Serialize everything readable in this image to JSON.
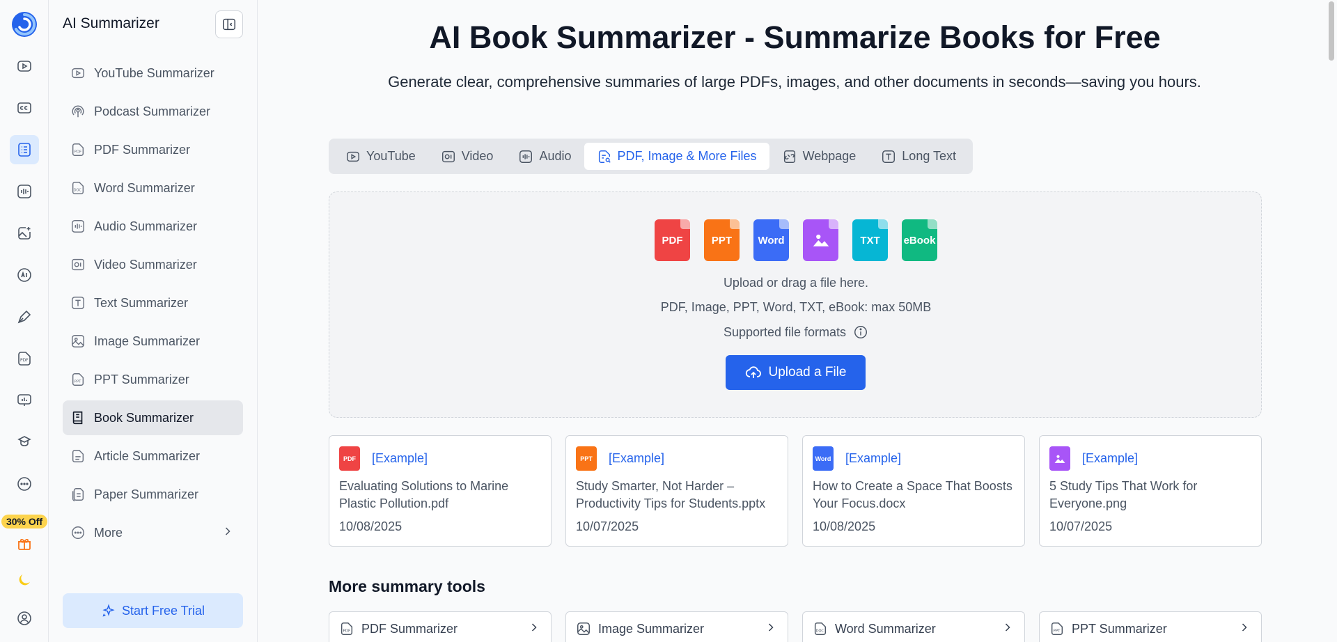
{
  "rail": {
    "items": [
      {
        "icon": "play-video-icon"
      },
      {
        "icon": "closed-caption-icon"
      },
      {
        "icon": "summary-list-icon",
        "active": true
      },
      {
        "icon": "audio-waveform-icon"
      },
      {
        "icon": "ai-image-icon"
      },
      {
        "icon": "ai-chat-icon"
      },
      {
        "icon": "pen-nib-icon"
      },
      {
        "icon": "pdf-file-icon"
      },
      {
        "icon": "presentation-chart-icon"
      },
      {
        "icon": "graduation-cap-icon"
      },
      {
        "icon": "more-dots-icon"
      }
    ],
    "promo_badge": "30% Off"
  },
  "sidebar": {
    "title": "AI Summarizer",
    "items": [
      {
        "label": "YouTube Summarizer",
        "icon": "youtube-icon"
      },
      {
        "label": "Podcast Summarizer",
        "icon": "podcast-icon"
      },
      {
        "label": "PDF Summarizer",
        "icon": "pdf-icon"
      },
      {
        "label": "Word Summarizer",
        "icon": "doc-icon"
      },
      {
        "label": "Audio Summarizer",
        "icon": "audio-icon"
      },
      {
        "label": "Video Summarizer",
        "icon": "video-icon"
      },
      {
        "label": "Text Summarizer",
        "icon": "text-icon"
      },
      {
        "label": "Image Summarizer",
        "icon": "image-icon"
      },
      {
        "label": "PPT Summarizer",
        "icon": "ppt-icon"
      },
      {
        "label": "Book Summarizer",
        "icon": "book-icon",
        "active": true
      },
      {
        "label": "Article Summarizer",
        "icon": "article-icon"
      },
      {
        "label": "Paper Summarizer",
        "icon": "paper-icon"
      },
      {
        "label": "More",
        "icon": "more-icon"
      }
    ],
    "cta": "Start Free Trial"
  },
  "main": {
    "title": "AI Book Summarizer - Summarize Books for Free",
    "subtitle": "Generate clear, comprehensive summaries of large PDFs, images, and other documents in seconds—saving you hours.",
    "tabs": [
      {
        "label": "YouTube"
      },
      {
        "label": "Video"
      },
      {
        "label": "Audio"
      },
      {
        "label": "PDF, Image & More Files",
        "active": true
      },
      {
        "label": "Webpage"
      },
      {
        "label": "Long Text"
      }
    ],
    "dropzone": {
      "file_types": [
        {
          "label": "PDF",
          "color": "#ef4444"
        },
        {
          "label": "PPT",
          "color": "#f97316"
        },
        {
          "label": "Word",
          "color": "#3b6cf6"
        },
        {
          "label": "",
          "color": "#a855f7"
        },
        {
          "label": "TXT",
          "color": "#06b6d4"
        },
        {
          "label": "eBook",
          "color": "#10b981"
        }
      ],
      "line1": "Upload or drag a file here.",
      "line2": "PDF, Image, PPT, Word, TXT, eBook: max 50MB",
      "line3": "Supported file formats",
      "button": "Upload a File"
    },
    "examples": [
      {
        "type": "PDF",
        "color": "#ef4444",
        "tag": "[Example]",
        "name": "Evaluating Solutions to Marine Plastic Pollution.pdf",
        "date": "10/08/2025"
      },
      {
        "type": "PPT",
        "color": "#f97316",
        "tag": "[Example]",
        "name": "Study Smarter, Not Harder – Productivity Tips for Students.pptx",
        "date": "10/07/2025"
      },
      {
        "type": "Word",
        "color": "#3b6cf6",
        "tag": "[Example]",
        "name": "How to Create a Space That Boosts Your Focus.docx",
        "date": "10/08/2025"
      },
      {
        "type": "",
        "color": "#a855f7",
        "tag": "[Example]",
        "name": "5 Study Tips That Work for Everyone.png",
        "date": "10/07/2025"
      }
    ],
    "more_tools_title": "More summary tools",
    "more_tools": [
      {
        "label": "PDF Summarizer"
      },
      {
        "label": "Image Summarizer"
      },
      {
        "label": "Word Summarizer"
      },
      {
        "label": "PPT Summarizer"
      }
    ]
  }
}
